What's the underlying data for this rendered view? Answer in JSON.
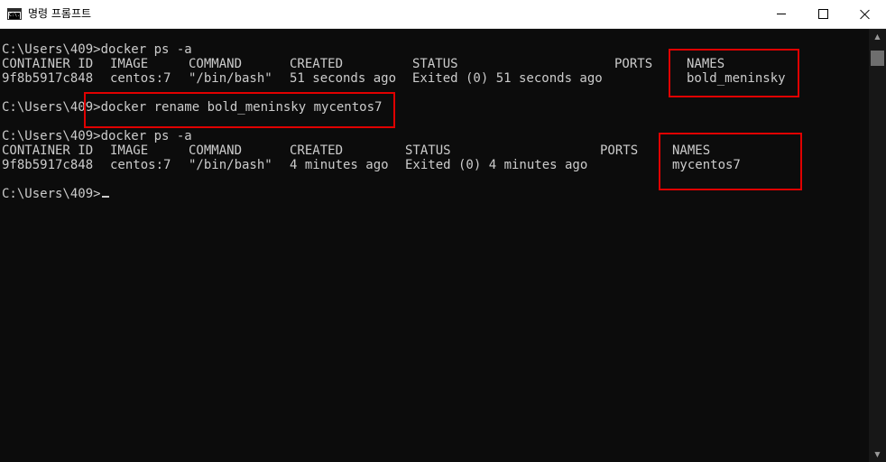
{
  "window": {
    "title": "명령 프롬프트",
    "icon_text": "C:\\."
  },
  "console": {
    "ps1": {
      "prompt": "C:\\Users\\409>",
      "command": "docker ps -a",
      "header": [
        "CONTAINER ID",
        "IMAGE",
        "COMMAND",
        "CREATED",
        "STATUS",
        "PORTS",
        "NAMES"
      ],
      "row": [
        "9f8b5917c848",
        "centos:7",
        "\"/bin/bash\"",
        "51 seconds ago",
        "Exited (0) 51 seconds ago",
        "",
        "bold_meninsky"
      ]
    },
    "rename": {
      "prompt": "C:\\Users\\409",
      "command": ">docker rename bold_meninsky mycentos7"
    },
    "ps2": {
      "prompt": "C:\\Users\\409>",
      "command": "docker ps -a",
      "header": [
        "CONTAINER ID",
        "IMAGE",
        "COMMAND",
        "CREATED",
        "STATUS",
        "PORTS",
        "NAMES"
      ],
      "row": [
        "9f8b5917c848",
        "centos:7",
        "\"/bin/bash\"",
        "4 minutes ago",
        "Exited (0) 4 minutes ago",
        "",
        "mycentos7"
      ]
    },
    "final_prompt": "C:\\Users\\409>"
  },
  "colors": {
    "background": "#0c0c0c",
    "text": "#cccccc",
    "highlight": "#e00000"
  },
  "icons": [
    "cmd-app-icon",
    "minimize-icon",
    "maximize-icon",
    "close-icon",
    "scroll-up-icon",
    "scroll-down-icon"
  ]
}
